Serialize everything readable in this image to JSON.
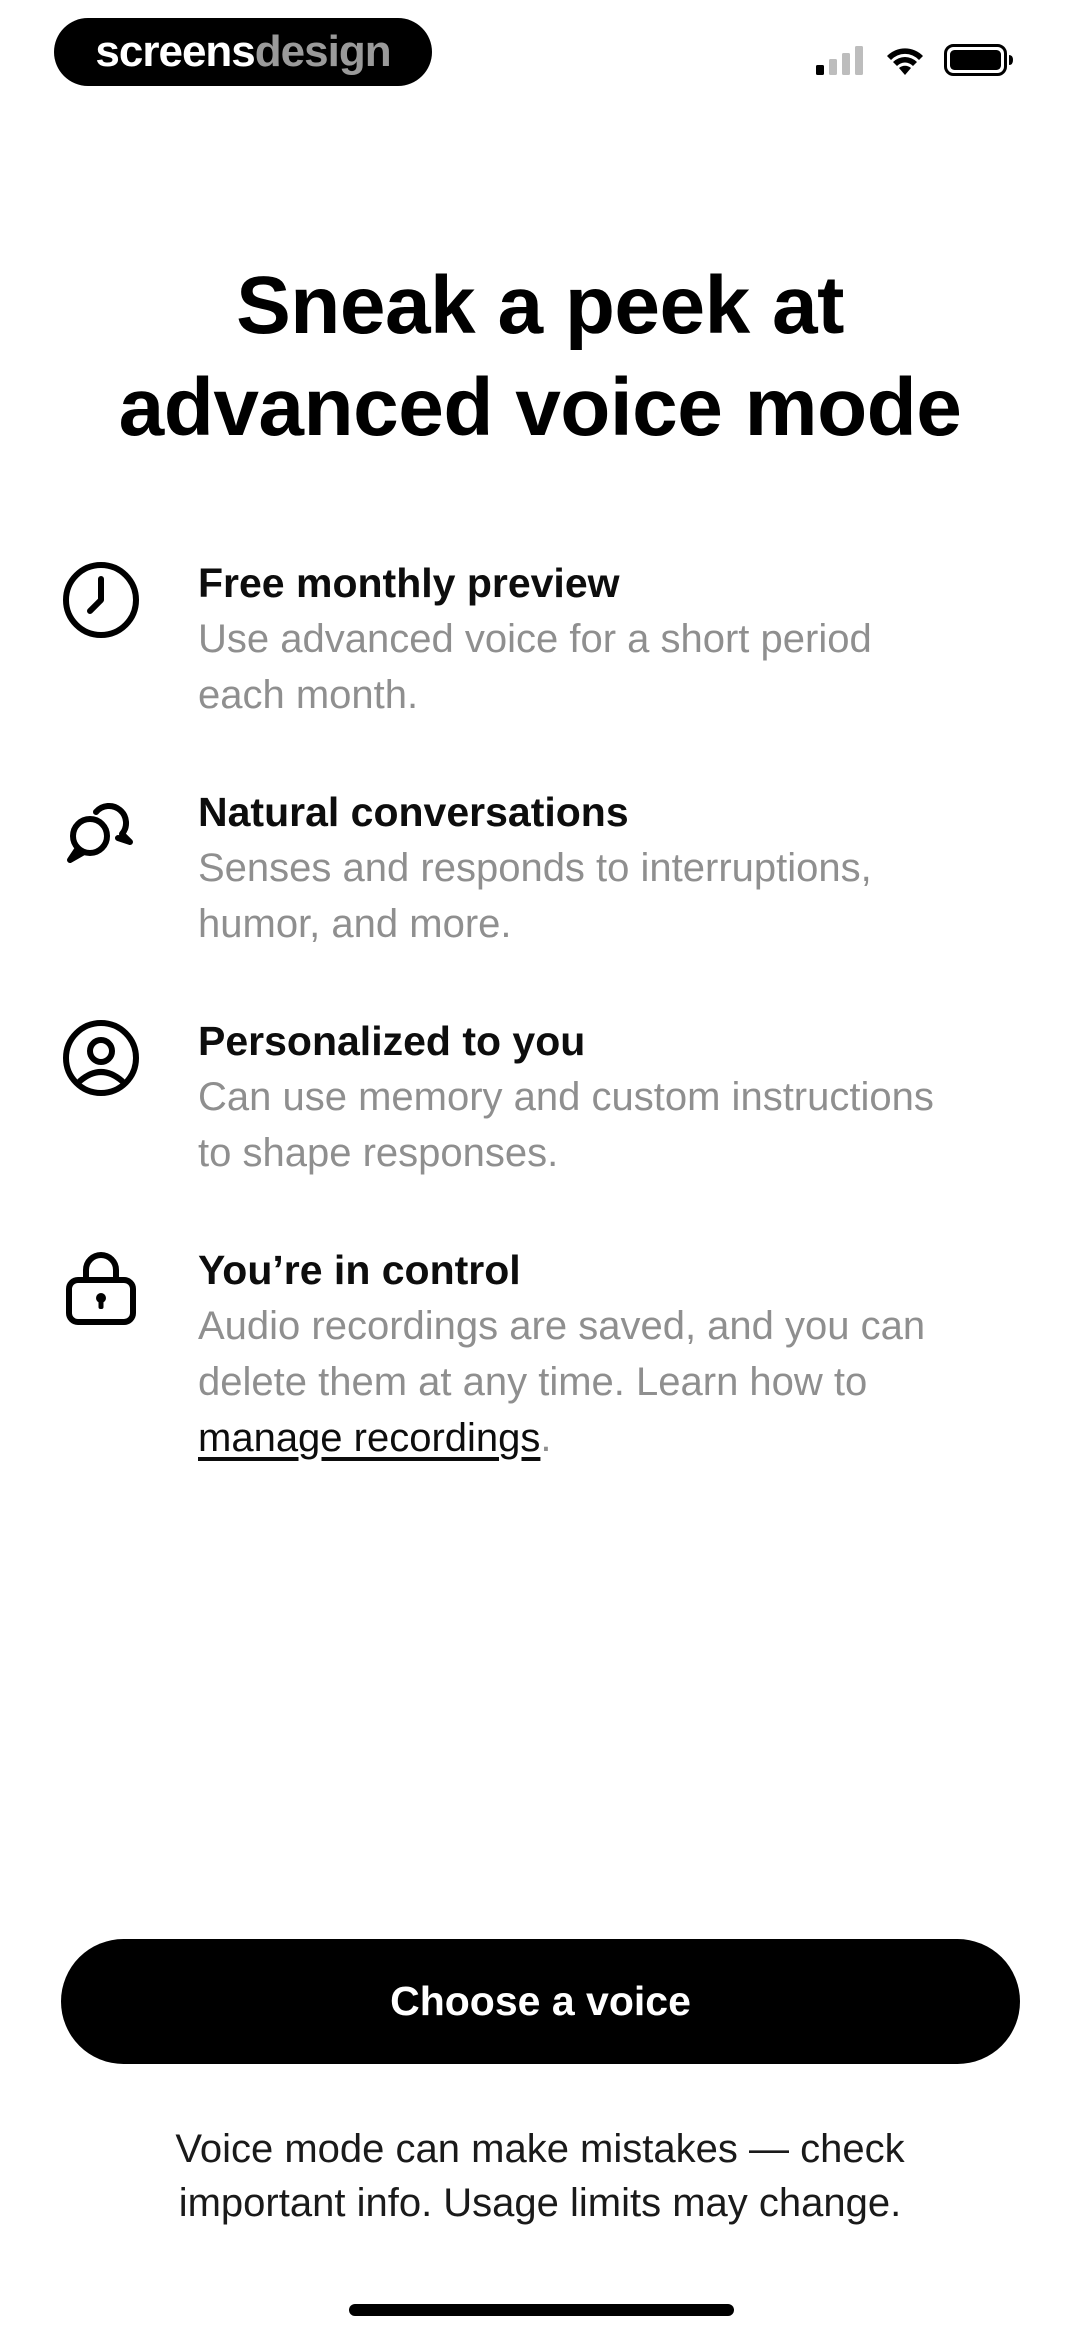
{
  "status_bar": {
    "brand_primary": "screens",
    "brand_secondary": "design",
    "icons": [
      "cellular-signal-icon",
      "wifi-icon",
      "battery-icon"
    ]
  },
  "header": {
    "title_line1": "Sneak a peek at",
    "title_line2": "advanced voice mode"
  },
  "features": [
    {
      "icon": "clock-icon",
      "title": "Free monthly preview",
      "desc_line1": "Use advanced voice for a short period",
      "desc_line2": "each month."
    },
    {
      "icon": "speech-bubbles-icon",
      "title": "Natural conversations",
      "desc_line1": "Senses and responds to interruptions,",
      "desc_line2": "humor, and more."
    },
    {
      "icon": "person-circle-icon",
      "title": "Personalized to you",
      "desc_line1": "Can use memory and custom instructions",
      "desc_line2": "to shape responses."
    },
    {
      "icon": "lock-icon",
      "title": "You’re in control",
      "desc_line1": "Audio recordings are saved, and you can",
      "desc_line2": "delete them at any time. Learn how to",
      "link_text": "manage recordings",
      "link_suffix": "."
    }
  ],
  "cta": {
    "label": "Choose a voice"
  },
  "disclaimer": {
    "line1": "Voice mode can make mistakes — check",
    "line2": "important info. Usage limits may change."
  },
  "colors": {
    "primary": "#000000",
    "secondary_text": "#8f8f8f",
    "background": "#ffffff"
  }
}
